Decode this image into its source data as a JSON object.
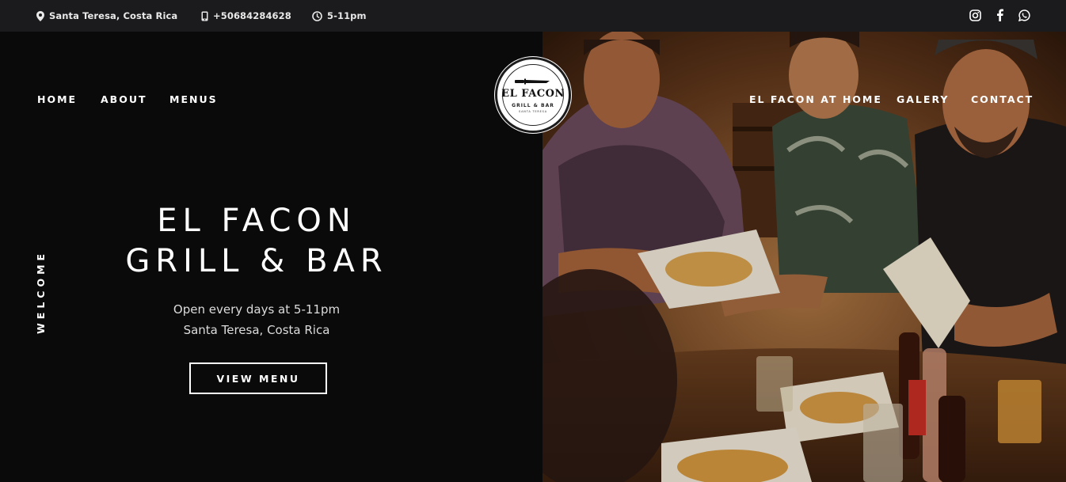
{
  "topbar": {
    "location": "Santa Teresa, Costa Rica",
    "phone": "+50684284628",
    "hours": "5-11pm",
    "social_icons": [
      "instagram-icon",
      "facebook-icon",
      "whatsapp-icon"
    ]
  },
  "nav": {
    "left": [
      "HOME",
      "ABOUT",
      "MENUS"
    ],
    "right": [
      "EL FACON AT HOME",
      "GALERY",
      "CONTACT"
    ]
  },
  "logo": {
    "title": "EL FACON",
    "subtitle": "GRILL & BAR",
    "tagline": "SANTA TERESA"
  },
  "hero": {
    "side_label": "WELCOME",
    "title_line1": "EL FACON",
    "title_line2": "GRILL & BAR",
    "subtitle_line1": "Open every days at 5-11pm",
    "subtitle_line2": "Santa Teresa, Costa Rica",
    "button": "VIEW MENU"
  },
  "colors": {
    "background": "#0a0a0b",
    "topbar": "#1b1b1d",
    "text": "#ffffff"
  }
}
